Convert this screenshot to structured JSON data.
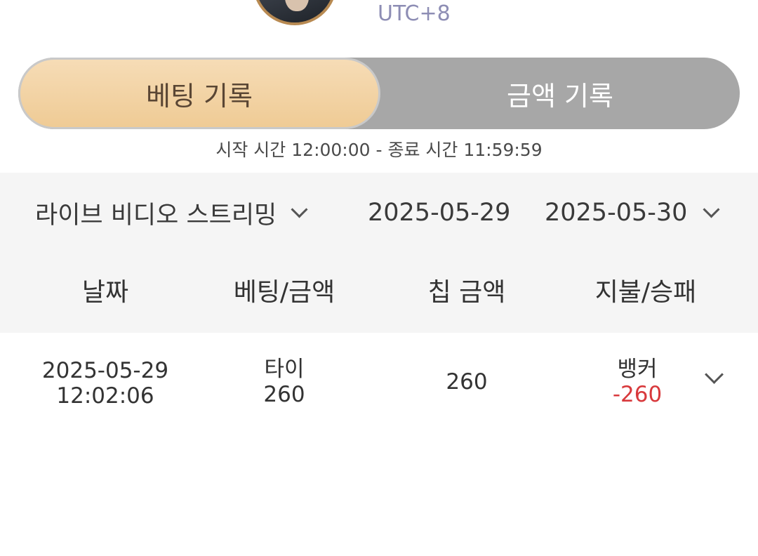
{
  "header": {
    "timezone": "UTC+8"
  },
  "tabs": [
    {
      "label": "베팅 기록",
      "active": true
    },
    {
      "label": "금액 기록",
      "active": false
    }
  ],
  "time_range": "시작 시간 12:00:00 - 종료 시간 11:59:59",
  "filters": {
    "game_type": "라이브 비디오 스트리밍",
    "start_date": "2025-05-29",
    "end_date": "2025-05-30"
  },
  "table": {
    "columns": [
      "날짜",
      "베팅/금액",
      "칩 금액",
      "지불/승패"
    ],
    "rows": [
      {
        "date": "2025-05-29",
        "time": "12:02:06",
        "bet": "타이",
        "bet_amount": "260",
        "chip_amount": "260",
        "payout_side": "뱅커",
        "payout_amount": "-260"
      }
    ]
  },
  "colors": {
    "accent": "#efcb95",
    "tab_bg": "#a7a7a7",
    "negative": "#d8393c",
    "timezone": "#8d8db4"
  }
}
